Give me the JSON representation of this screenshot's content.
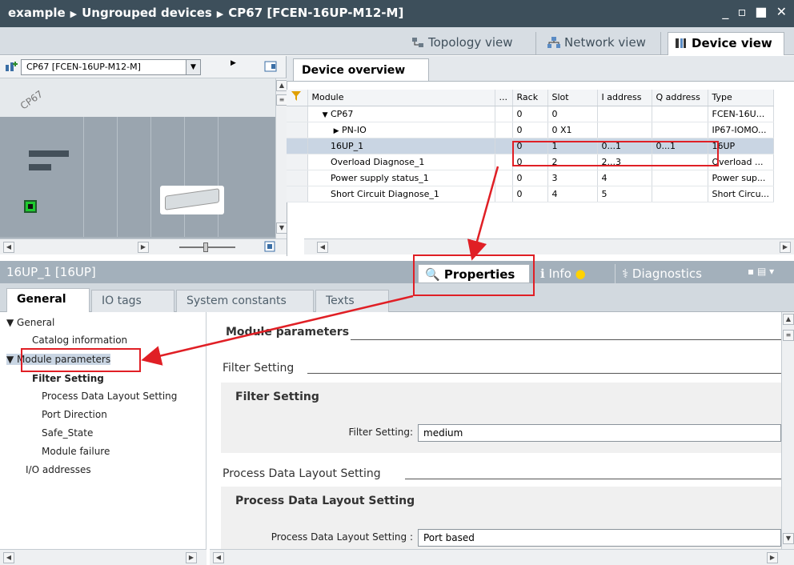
{
  "titlebar": {
    "crumb1": "example",
    "crumb2": "Ungrouped devices",
    "crumb3": "CP67 [FCEN-16UP-M12-M]",
    "controls": "_ ▫ ■ ✕"
  },
  "views": {
    "topology": "Topology view",
    "network": "Network view",
    "device": "Device view"
  },
  "device_select": "CP67 [FCEN-16UP-M12-M]",
  "canvas_label": "CP67",
  "overview_tab": "Device overview",
  "table": {
    "headers": [
      "Module",
      "...",
      "Rack",
      "Slot",
      "I address",
      "Q address",
      "Type"
    ],
    "rows": [
      {
        "module": "CP67",
        "rack": "0",
        "slot": "0",
        "i": "",
        "q": "",
        "type": "FCEN-16U...",
        "expand": "▼"
      },
      {
        "module": "PN-IO",
        "rack": "0",
        "slot": "0 X1",
        "i": "",
        "q": "",
        "type": "IP67-IOMO...",
        "expand": "▶"
      },
      {
        "module": "16UP_1",
        "rack": "0",
        "slot": "1",
        "i": "0...1",
        "q": "0...1",
        "type": "16UP",
        "expand": ""
      },
      {
        "module": "Overload Diagnose_1",
        "rack": "0",
        "slot": "2",
        "i": "2...3",
        "q": "",
        "type": "Overload ...",
        "expand": ""
      },
      {
        "module": "Power supply status_1",
        "rack": "0",
        "slot": "3",
        "i": "4",
        "q": "",
        "type": "Power sup...",
        "expand": ""
      },
      {
        "module": "Short Circuit Diagnose_1",
        "rack": "0",
        "slot": "4",
        "i": "5",
        "q": "",
        "type": "Short Circu...",
        "expand": ""
      }
    ]
  },
  "props": {
    "title": "16UP_1 [16UP]",
    "properties": "Properties",
    "info": "Info",
    "diagnostics": "Diagnostics"
  },
  "subtabs": {
    "general": "General",
    "iotags": "IO tags",
    "sysconst": "System constants",
    "texts": "Texts"
  },
  "nav": {
    "general": "▼ General",
    "catalog": "Catalog information",
    "modparams": "▼ Module parameters",
    "filter": "Filter Setting",
    "pdl": "Process Data Layout Setting",
    "portdir": "Port Direction",
    "safe": "Safe_State",
    "modfail": "Module failure",
    "io": "I/O addresses"
  },
  "content": {
    "module_parameters": "Module parameters",
    "filter_section": "Filter Setting",
    "filter_group": "Filter Setting",
    "filter_label": "Filter Setting:",
    "filter_value": "medium",
    "pdl_section": "Process Data Layout Setting",
    "pdl_group": "Process Data Layout Setting",
    "pdl_label": "Process Data Layout Setting :",
    "pdl_value": "Port based"
  },
  "colors": {
    "highlight": "#e01f25",
    "titlebar": "#3d4f5b",
    "selected_row": "#c9d5e3"
  }
}
